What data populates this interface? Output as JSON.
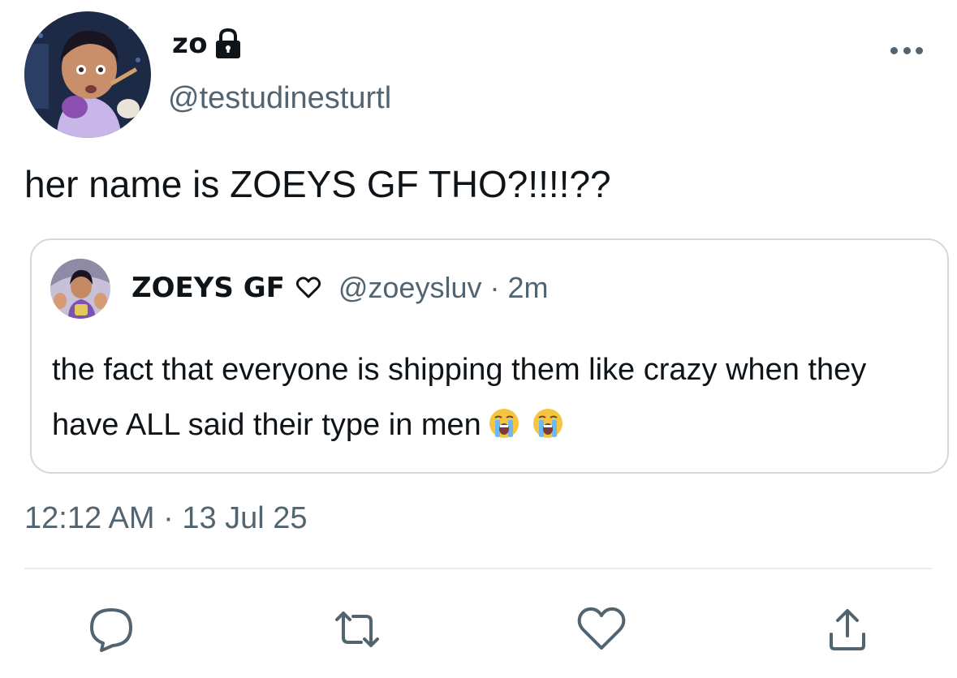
{
  "author": {
    "display_name": "zo",
    "handle": "@testudinesturtl",
    "avatar_icon": "avatar-image",
    "lock_icon": "lock-icon"
  },
  "more_icon": "more-options-icon",
  "tweet": {
    "text": "her name is ZOEYS GF THO?!!!!??",
    "timestamp": "12:12 AM · 13 Jul 25"
  },
  "quoted": {
    "display_name": "ZOEYS GF",
    "handle": "@zoeysluv",
    "separator": "·",
    "time": "2m",
    "text": "the fact that everyone is shipping them like crazy when they have ALL said their type in men",
    "emoji": [
      "loudly-crying-face",
      "loudly-crying-face"
    ]
  },
  "actions": [
    "reply-icon",
    "retweet-icon",
    "like-icon",
    "share-icon"
  ],
  "colors": {
    "text": "#0f1419",
    "secondary": "#536471",
    "border": "#cfd9de"
  }
}
